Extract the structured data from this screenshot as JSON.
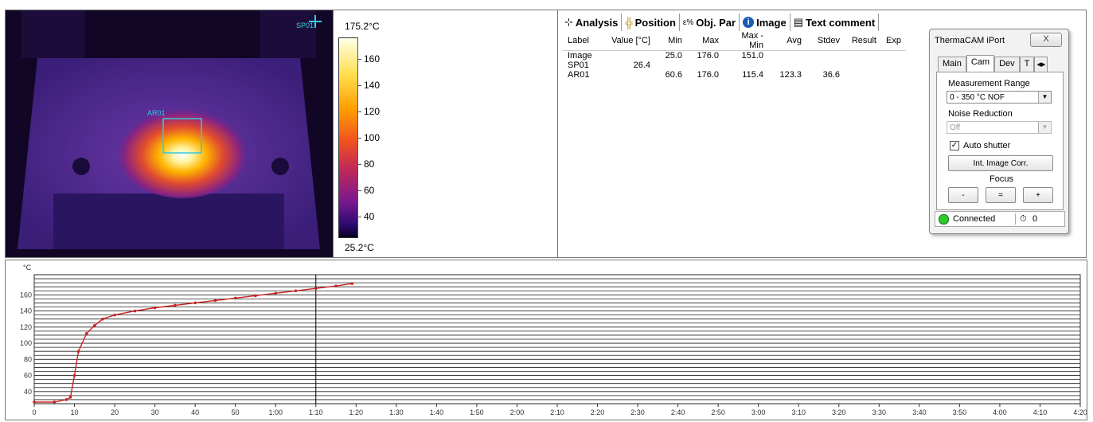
{
  "thermal": {
    "spot_label": "SP01",
    "area_label": "AR01"
  },
  "scale": {
    "max_label": "175.2°C",
    "min_label": "25.2°C",
    "ticks": [
      "160",
      "140",
      "120",
      "100",
      "80",
      "60",
      "40"
    ]
  },
  "analysis": {
    "tabs": [
      {
        "label": "Analysis",
        "icon": "analysis-icon"
      },
      {
        "label": "Position",
        "icon": "position-icon"
      },
      {
        "label": "Obj. Par",
        "icon": "object-parameters-icon"
      },
      {
        "label": "Image",
        "icon": "info-icon"
      },
      {
        "label": "Text comment",
        "icon": "text-comment-icon"
      }
    ],
    "columns": [
      "Label",
      "Value [°C]",
      "Min",
      "Max",
      "Max - Min",
      "Avg",
      "Stdev",
      "Result",
      "Exp"
    ],
    "rows": [
      [
        "Image",
        "",
        "25.0",
        "176.0",
        "151.0",
        "",
        "",
        "",
        ""
      ],
      [
        "SP01",
        "26.4",
        "",
        "",
        "",
        "",
        "",
        "",
        ""
      ],
      [
        "AR01",
        "",
        "60.6",
        "176.0",
        "115.4",
        "123.3",
        "36.6",
        "",
        ""
      ]
    ]
  },
  "iport": {
    "title": "ThermaCAM iPort",
    "close_glyph": "X",
    "tabs": [
      "Main",
      "Cam",
      "Dev",
      "T"
    ],
    "active_tab": "Cam",
    "measurement_range_label": "Measurement Range",
    "measurement_range_value": "0 - 350 °C NOF",
    "noise_reduction_label": "Noise Reduction",
    "noise_reduction_value": "Off",
    "auto_shutter_label": "Auto shutter",
    "int_image_corr_label": "Int. Image Corr.",
    "focus_label": "Focus",
    "focus_buttons": [
      "-",
      "=",
      "+"
    ],
    "status": "Connected",
    "counter": "0"
  },
  "colors": {
    "curve": "#cc2222",
    "roi": "#33c8e0",
    "spot": "#33d0e0"
  },
  "chart_data": {
    "type": "line",
    "ylabel": "°C",
    "ylim": [
      25,
      185
    ],
    "xlim": [
      0,
      260
    ],
    "y_ticks": [
      40,
      60,
      80,
      100,
      120,
      140,
      160
    ],
    "x_ticks": [
      "0",
      "10",
      "20",
      "30",
      "40",
      "50",
      "1:00",
      "1:10",
      "1:20",
      "1:30",
      "1:40",
      "1:50",
      "2:00",
      "2:10",
      "2:20",
      "2:30",
      "2:40",
      "2:50",
      "3:00",
      "3:10",
      "3:20",
      "3:30",
      "3:40",
      "3:50",
      "4:00",
      "4:10",
      "4:20"
    ],
    "cursor_x": 70,
    "series": [
      {
        "x": [
          0,
          5,
          8,
          9,
          10,
          11,
          13,
          15,
          17,
          20,
          25,
          30,
          35,
          40,
          45,
          50,
          55,
          60,
          65,
          70,
          75,
          79
        ],
        "y": [
          27,
          27,
          30,
          33,
          60,
          90,
          112,
          122,
          130,
          135,
          140,
          144,
          147,
          150,
          153,
          156,
          159,
          162,
          165,
          168,
          171,
          174
        ]
      }
    ]
  }
}
